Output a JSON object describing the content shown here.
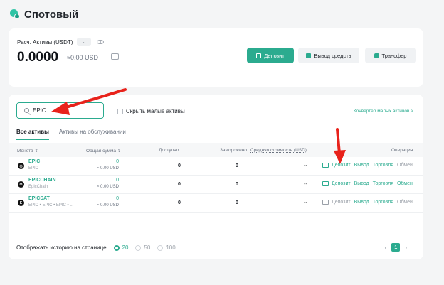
{
  "page": {
    "title": "Спотовый"
  },
  "balance": {
    "label": "Расч. Активы (USDT)",
    "currency_chevron": "⌄",
    "value": "0.0000",
    "usd": "≈0.00 USD"
  },
  "actions": {
    "deposit": "Депозит",
    "withdraw": "Вывод средств",
    "transfer": "Трансфер"
  },
  "search": {
    "value": "EPIC"
  },
  "filters": {
    "hide_small": "Скрыть малые активы",
    "convert_small": "Конвертер малых активов >"
  },
  "tabs": [
    "Все активы",
    "Активы на обслуживании"
  ],
  "table": {
    "headers": {
      "coin": "Монета ⇕",
      "total": "Общая сумма ⇕",
      "available": "Доступно",
      "frozen": "Заморожено",
      "avg_cost": "Средняя стоимость (USD)",
      "operation": "Операция"
    },
    "rows": [
      {
        "symbol": "EPIC",
        "full_name": "EPIC",
        "logo": "◎",
        "total": "0",
        "total_usd": "≈ 0.00 USD",
        "available": "0",
        "frozen": "0",
        "avg_cost": "--",
        "ops": [
          "Депозит",
          "Вывод",
          "Торговля",
          "Обмен"
        ]
      },
      {
        "symbol": "EPICCHAIN",
        "full_name": "EpicChain",
        "logo": "Ꙩ",
        "total": "0",
        "total_usd": "≈ 0.00 USD",
        "available": "0",
        "frozen": "0",
        "avg_cost": "--",
        "ops": [
          "Депозит",
          "Вывод",
          "Торговля",
          "Обмен"
        ]
      },
      {
        "symbol": "EPICSAT",
        "full_name": "EPIC • EPIC • EPIC • ...",
        "logo": "E",
        "total": "0",
        "total_usd": "≈ 0.00 USD",
        "available": "0",
        "frozen": "0",
        "avg_cost": "--",
        "ops": [
          "Депозит",
          "Вывод",
          "Торговля",
          "Обмен"
        ]
      }
    ]
  },
  "pager": {
    "label": "Отображать историю на странице",
    "options": [
      "20",
      "50",
      "100"
    ],
    "selected": "20",
    "page": "1",
    "prev": "‹",
    "next": "›"
  },
  "colors": {
    "accent": "#2bab8f",
    "annotation": "#e8221b"
  }
}
